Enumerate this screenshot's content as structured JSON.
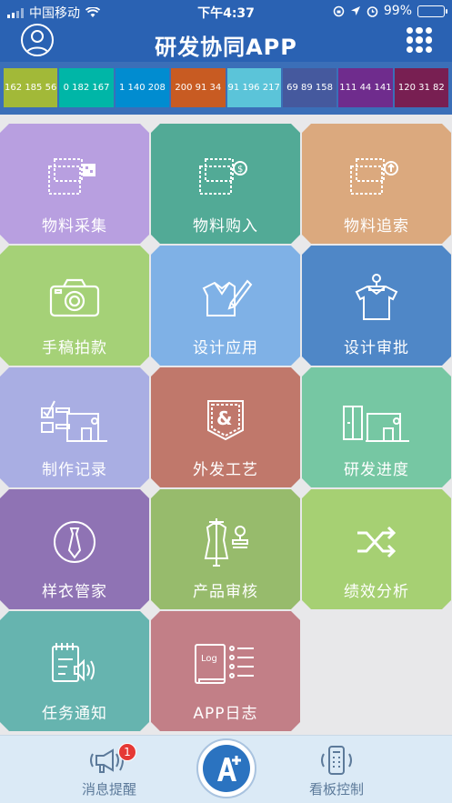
{
  "status": {
    "carrier": "中国移动",
    "time": "下午4:37",
    "battery": "99%",
    "battery_level": 0.99
  },
  "header": {
    "title": "研发协同APP"
  },
  "swatches": [
    {
      "label": "162 185 56",
      "color": "#a2b938"
    },
    {
      "label": "0 182 167",
      "color": "#00b6a7"
    },
    {
      "label": "1 140 208",
      "color": "#018cd0"
    },
    {
      "label": "200 91 34",
      "color": "#c85b22"
    },
    {
      "label": "91 196 217",
      "color": "#5bc4d9"
    },
    {
      "label": "69 89 158",
      "color": "#45599e"
    },
    {
      "label": "111 44 141",
      "color": "#6f2c8d"
    },
    {
      "label": "120 31 82",
      "color": "#781f52"
    }
  ],
  "tiles": [
    {
      "label": "物料采集",
      "color": "#b89fe0",
      "icon": "material-collect-icon"
    },
    {
      "label": "物料购入",
      "color": "#52aa96",
      "icon": "material-purchase-icon"
    },
    {
      "label": "物料追索",
      "color": "#dba97e",
      "icon": "material-trace-icon"
    },
    {
      "label": "手稿拍款",
      "color": "#a5d177",
      "icon": "camera-icon"
    },
    {
      "label": "设计应用",
      "color": "#7fb1e6",
      "icon": "design-apply-icon"
    },
    {
      "label": "设计审批",
      "color": "#4f87c7",
      "icon": "design-approve-icon"
    },
    {
      "label": "制作记录",
      "color": "#a9aee3",
      "icon": "sewing-checklist-icon"
    },
    {
      "label": "外发工艺",
      "color": "#c0786b",
      "icon": "pocket-icon"
    },
    {
      "label": "研发进度",
      "color": "#76c7a3",
      "icon": "sewing-progress-icon"
    },
    {
      "label": "样衣管家",
      "color": "#8f73b4",
      "icon": "tie-icon"
    },
    {
      "label": "产品审核",
      "color": "#97bb6c",
      "icon": "mannequin-stamp-icon"
    },
    {
      "label": "绩效分析",
      "color": "#a6d073",
      "icon": "shuffle-icon"
    },
    {
      "label": "任务通知",
      "color": "#66b4af",
      "icon": "notepad-speaker-icon"
    },
    {
      "label": "APP日志",
      "color": "#c27f87",
      "icon": "log-book-icon"
    }
  ],
  "tabs": {
    "messages_label": "消息提醒",
    "messages_badge": "1",
    "board_label": "看板控制"
  }
}
